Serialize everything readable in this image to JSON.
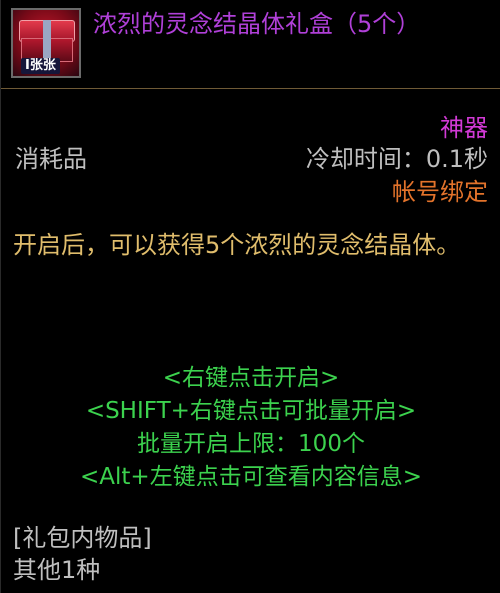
{
  "item": {
    "icon_name": "gift-box-icon",
    "icon_tag": "I张张",
    "name": "浓烈的灵念结晶体礼盒（5个）",
    "rarity": "神器",
    "category": "消耗品",
    "cooldown": "冷却时间：0.1秒",
    "binding": "帐号绑定",
    "description": "开启后，可以获得5个浓烈的灵念结晶体。"
  },
  "instructions": [
    "<右键点击开启>",
    "<SHIFT+右键点击可批量开启>",
    "批量开启上限：100个",
    "<Alt+左键点击可查看内容信息>"
  ],
  "contents": {
    "title": "[礼包内物品]",
    "summary": "其他1种"
  },
  "colors": {
    "name": "#b040d8",
    "rarity": "#d23ad6",
    "binding": "#e3732b",
    "description": "#e0bd6c",
    "instructions": "#3cd24e",
    "normal_text": "#bfbfbf",
    "background": "#000000"
  }
}
